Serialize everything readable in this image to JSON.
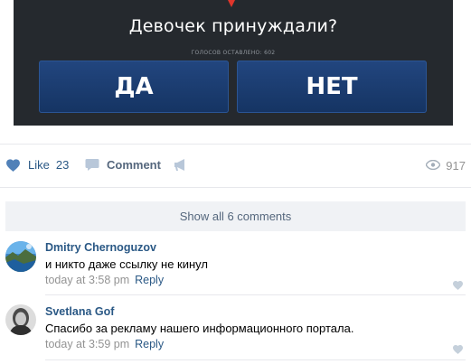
{
  "poll": {
    "question": "Девочек принуждали?",
    "votes_text": "ГОЛОСОВ ОСТАВЛЕНО: 602",
    "option_yes": "ДА",
    "option_no": "НЕТ"
  },
  "actions": {
    "like_label": "Like",
    "like_count": "23",
    "comment_label": "Comment",
    "views_count": "917"
  },
  "comments_section": {
    "show_all_label": "Show all 6 comments",
    "items": [
      {
        "author": "Dmitry Chernoguzov",
        "text": "и никто даже ссылку не кинул",
        "time": "today at 3:58 pm",
        "reply_label": "Reply"
      },
      {
        "author": "Svetlana Gof",
        "text": "Спасибо за рекламу нашего информационного портала.",
        "time": "today at 3:59 pm",
        "reply_label": "Reply"
      }
    ]
  },
  "colors": {
    "link": "#2a5885",
    "poll_background": "#25292e",
    "poll_button": "#1c3d70",
    "muted": "#939393",
    "like_icon": "#5181b8"
  }
}
